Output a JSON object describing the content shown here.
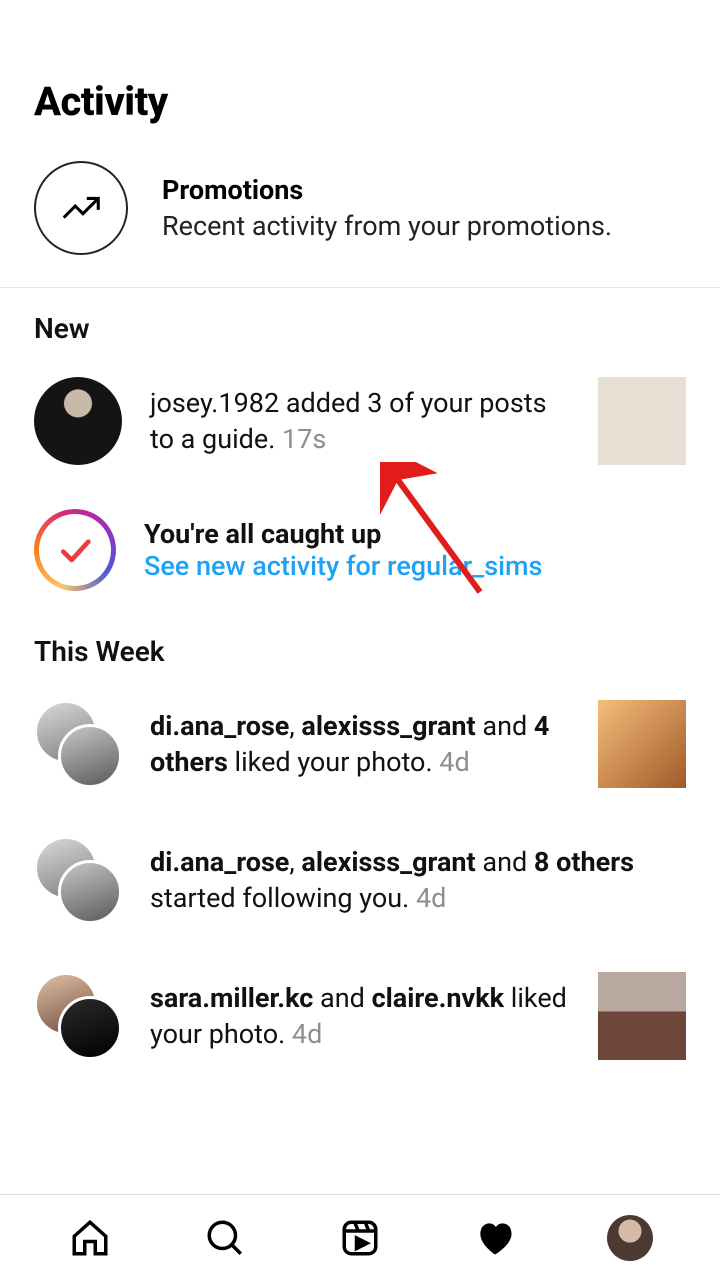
{
  "header": {
    "title": "Activity"
  },
  "promotions": {
    "title": "Promotions",
    "subtitle": "Recent activity from your promotions."
  },
  "sections": {
    "new_label": "New",
    "this_week_label": "This Week"
  },
  "new_items": [
    {
      "text_prefix": "josey.1982",
      "text_rest": " added 3 of your posts to a guide. ",
      "time": "17s"
    }
  ],
  "caught_up": {
    "title": "You're all caught up",
    "link_label": "See new activity for regular_sims"
  },
  "week_items": [
    {
      "u1": "di.ana_rose",
      "sep1": ", ",
      "u2": "alexisss_grant",
      "mid": " and ",
      "u3": "4 others",
      "rest": " liked your photo. ",
      "time": "4d",
      "thumb": true
    },
    {
      "u1": "di.ana_rose",
      "sep1": ", ",
      "u2": "alexisss_grant",
      "mid": " and ",
      "u3": "8 others",
      "rest": " started following you. ",
      "time": "4d",
      "thumb": false
    },
    {
      "u1": "sara.miller.kc",
      "sep1": " and ",
      "u2": "claire.nvkk",
      "mid": "",
      "u3": "",
      "rest": " liked your photo. ",
      "time": "4d",
      "thumb": true
    }
  ],
  "annotation": {
    "kind": "arrow-pointer"
  }
}
